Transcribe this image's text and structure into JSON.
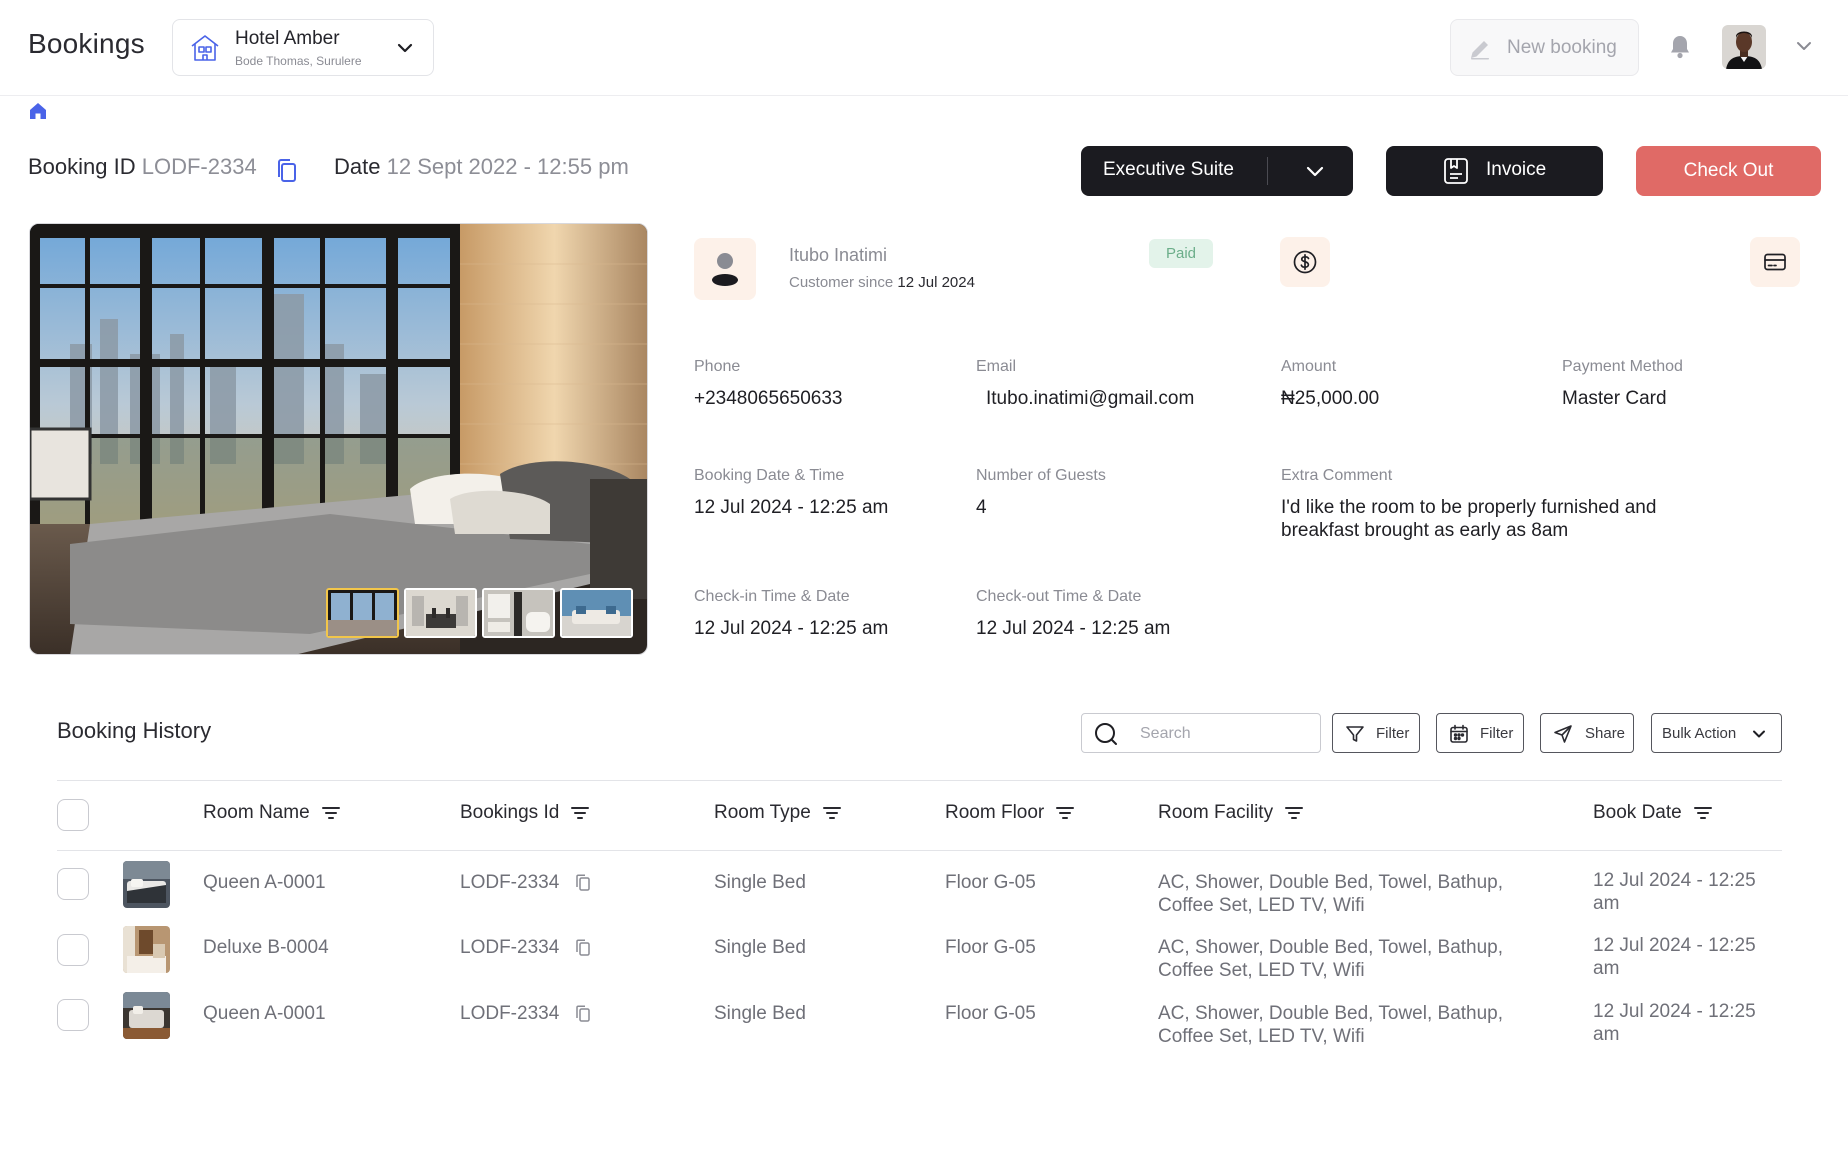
{
  "header": {
    "title": "Bookings",
    "hotel": {
      "name": "Hotel Amber",
      "address": "Bode Thomas, Surulere"
    },
    "new_booking_label": "New booking"
  },
  "booking": {
    "id_label": "Booking ID",
    "id_value": "LODF-2334",
    "date_label": "Date",
    "date_value": "12 Sept 2022 - 12:55 pm",
    "room_select": "Executive Suite",
    "invoice_label": "Invoice",
    "checkout_label": "Check Out"
  },
  "customer": {
    "name": "Itubo Inatimi",
    "since_label": "Customer since",
    "since_date": "12 Jul 2024",
    "status": "Paid"
  },
  "details": {
    "phone": {
      "label": "Phone",
      "value": "+2348065650633"
    },
    "email": {
      "label": "Email",
      "value": "Itubo.inatimi@gmail.com"
    },
    "amount": {
      "label": "Amount",
      "value": "₦25,000.00"
    },
    "payment_method": {
      "label": "Payment Method",
      "value": "Master Card"
    },
    "booking_datetime": {
      "label": "Booking Date & Time",
      "value": "12 Jul 2024 - 12:25 am"
    },
    "guests": {
      "label": "Number of Guests",
      "value": "4"
    },
    "comment": {
      "label": "Extra Comment",
      "line1": "I'd like the room to be properly furnished and",
      "line2": "breakfast brought as early as 8am"
    },
    "checkin": {
      "label": "Check-in Time & Date",
      "value": "12 Jul 2024 - 12:25 am"
    },
    "checkout": {
      "label": "Check-out Time & Date",
      "value": "12 Jul 2024 - 12:25 am"
    }
  },
  "history": {
    "title": "Booking History",
    "search_placeholder": "Search",
    "filter_label": "Filter",
    "date_filter_label": "Filter",
    "share_label": "Share",
    "bulk_action_label": "Bulk Action",
    "columns": [
      "Room Name",
      "Bookings Id",
      "Room Type",
      "Room Floor",
      "Room Facility",
      "Book Date"
    ],
    "rows": [
      {
        "room_name": "Queen A-0001",
        "booking_id": "LODF-2334",
        "room_type": "Single Bed",
        "floor": "Floor G-05",
        "facility_1": "AC, Shower, Double Bed, Towel, Bathup,",
        "facility_2": "Coffee Set, LED TV, Wifi",
        "date_1": "12 Jul 2024 - 12:25",
        "date_2": "am"
      },
      {
        "room_name": "Deluxe B-0004",
        "booking_id": "LODF-2334",
        "room_type": "Single Bed",
        "floor": "Floor G-05",
        "facility_1": "AC, Shower, Double Bed, Towel, Bathup,",
        "facility_2": "Coffee Set, LED TV, Wifi",
        "date_1": "12 Jul 2024 - 12:25",
        "date_2": "am"
      },
      {
        "room_name": "Queen A-0001",
        "booking_id": "LODF-2334",
        "room_type": "Single Bed",
        "floor": "Floor G-05",
        "facility_1": "AC, Shower, Double Bed, Towel, Bathup,",
        "facility_2": "Coffee Set, LED TV, Wifi",
        "date_1": "12 Jul 2024 - 12:25",
        "date_2": "am"
      }
    ]
  },
  "colors": {
    "primary_dark": "#1b1b20",
    "checkout_red": "#e06a66",
    "paid_green": "#6cae8a",
    "tile_peach": "#fdf1e9",
    "home_blue": "#4a63e8"
  },
  "icons": [
    "hotel-icon",
    "chevron-down-icon",
    "pen-icon",
    "bell-icon",
    "home-icon",
    "copy-icon",
    "invoice-icon",
    "user-icon",
    "dollar-icon",
    "card-icon",
    "search-icon",
    "filter-icon",
    "calendar-icon",
    "send-icon",
    "sort-icon"
  ]
}
